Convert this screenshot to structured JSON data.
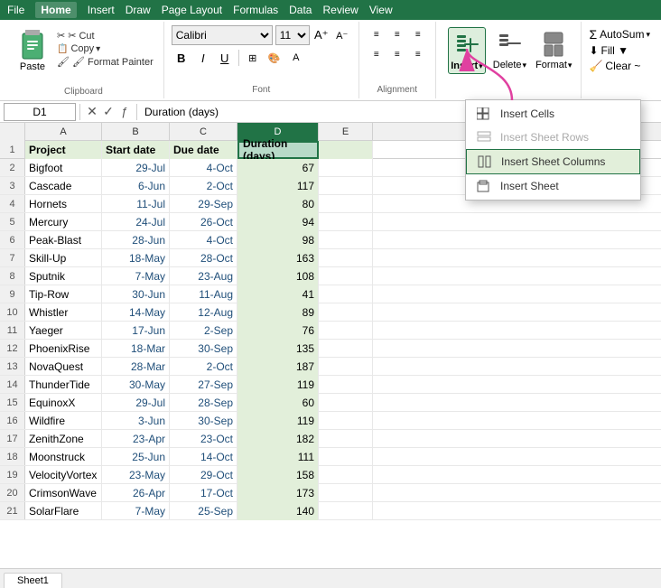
{
  "menubar": {
    "items": [
      "File",
      "Home",
      "Insert",
      "Draw",
      "Page Layout",
      "Formulas",
      "Data",
      "Review",
      "View"
    ]
  },
  "ribbon": {
    "groups": {
      "clipboard": {
        "label": "Clipboard",
        "paste": "Paste",
        "cut": "✂ Cut",
        "copy": "📋 Copy",
        "format_painter": "🖌 Format Painter"
      },
      "font": {
        "label": "Font",
        "font_name": "Calibri",
        "font_size": "11",
        "bold": "B",
        "italic": "I",
        "underline": "U"
      },
      "insert": {
        "label": "Insert",
        "delete": "Delete",
        "format": "Format"
      },
      "autosum": {
        "autosum": "AutoSum",
        "fill": "Fill ▼",
        "clear": "Clear ~"
      }
    }
  },
  "formula_bar": {
    "cell_ref": "D1",
    "formula": "Duration (days)"
  },
  "columns": {
    "headers": [
      "A",
      "B",
      "C",
      "D",
      "E"
    ],
    "labels": [
      "Project",
      "Start date",
      "Due date",
      "Duration (days)",
      ""
    ]
  },
  "rows": [
    {
      "row": 2,
      "project": "Bigfoot",
      "start": "29-Jul",
      "due": "4-Oct",
      "duration": 67
    },
    {
      "row": 3,
      "project": "Cascade",
      "start": "6-Jun",
      "due": "2-Oct",
      "duration": 117
    },
    {
      "row": 4,
      "project": "Hornets",
      "start": "11-Jul",
      "due": "29-Sep",
      "duration": 80
    },
    {
      "row": 5,
      "project": "Mercury",
      "start": "24-Jul",
      "due": "26-Oct",
      "duration": 94
    },
    {
      "row": 6,
      "project": "Peak-Blast",
      "start": "28-Jun",
      "due": "4-Oct",
      "duration": 98
    },
    {
      "row": 7,
      "project": "Skill-Up",
      "start": "18-May",
      "due": "28-Oct",
      "duration": 163
    },
    {
      "row": 8,
      "project": "Sputnik",
      "start": "7-May",
      "due": "23-Aug",
      "duration": 108
    },
    {
      "row": 9,
      "project": "Tip-Row",
      "start": "30-Jun",
      "due": "11-Aug",
      "duration": 41
    },
    {
      "row": 10,
      "project": "Whistler",
      "start": "14-May",
      "due": "12-Aug",
      "duration": 89
    },
    {
      "row": 11,
      "project": "Yaeger",
      "start": "17-Jun",
      "due": "2-Sep",
      "duration": 76
    },
    {
      "row": 12,
      "project": "PhoenixRise",
      "start": "18-Mar",
      "due": "30-Sep",
      "duration": 135
    },
    {
      "row": 13,
      "project": "NovaQuest",
      "start": "28-Mar",
      "due": "2-Oct",
      "duration": 187
    },
    {
      "row": 14,
      "project": "ThunderTide",
      "start": "30-May",
      "due": "27-Sep",
      "duration": 119
    },
    {
      "row": 15,
      "project": "EquinoxX",
      "start": "29-Jul",
      "due": "28-Sep",
      "duration": 60
    },
    {
      "row": 16,
      "project": "Wildfire",
      "start": "3-Jun",
      "due": "30-Sep",
      "duration": 119
    },
    {
      "row": 17,
      "project": "ZenithZone",
      "start": "23-Apr",
      "due": "23-Oct",
      "duration": 182
    },
    {
      "row": 18,
      "project": "Moonstruck",
      "start": "25-Jun",
      "due": "14-Oct",
      "duration": 111
    },
    {
      "row": 19,
      "project": "VelocityVortex",
      "start": "23-May",
      "due": "29-Oct",
      "duration": 158
    },
    {
      "row": 20,
      "project": "CrimsonWave",
      "start": "26-Apr",
      "due": "17-Oct",
      "duration": 173
    },
    {
      "row": 21,
      "project": "SolarFlare",
      "start": "7-May",
      "due": "25-Sep",
      "duration": 140
    }
  ],
  "context_menu": {
    "items": [
      {
        "label": "Insert Cells",
        "icon": "⊞",
        "disabled": false,
        "highlighted": false
      },
      {
        "label": "Insert Sheet Rows",
        "icon": "⊟",
        "disabled": true,
        "highlighted": false
      },
      {
        "label": "Insert Sheet Columns",
        "icon": "⊞",
        "disabled": false,
        "highlighted": true
      },
      {
        "label": "Insert Sheet",
        "icon": "⊟",
        "disabled": false,
        "highlighted": false
      }
    ]
  },
  "sheet_tab": "Sheet1",
  "colors": {
    "excel_green": "#217346",
    "selected_col_bg": "#e2efda",
    "header_bg": "#f0f0f0"
  }
}
